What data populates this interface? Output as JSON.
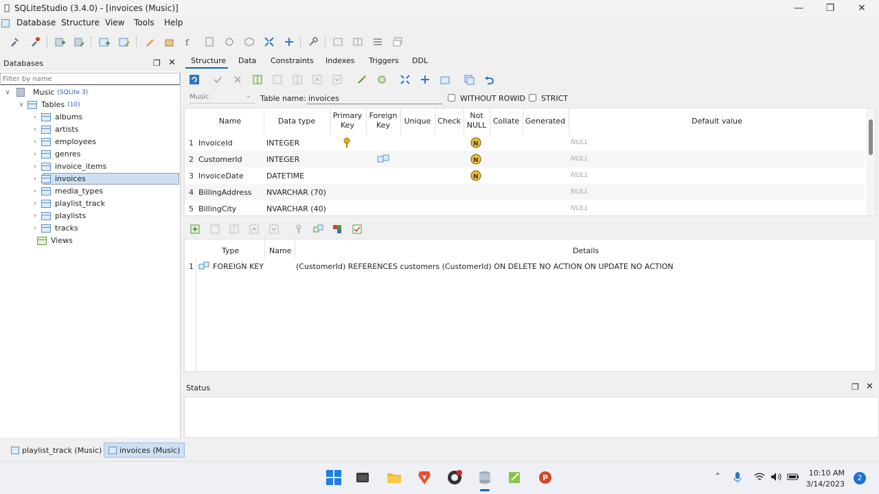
{
  "window": {
    "title": "SQLiteStudio (3.4.0) - [invoices (Music)]"
  },
  "menu": [
    "Database",
    "Structure",
    "View",
    "Tools",
    "Help"
  ],
  "db_panel": {
    "title": "Databases",
    "filter_placeholder": "Filter by name",
    "db_name": "Music",
    "db_version": "(SQLite 3)",
    "tables_label": "Tables",
    "tables_count": "(10)",
    "tables": [
      "albums",
      "artists",
      "employees",
      "genres",
      "invoice_items",
      "invoices",
      "media_types",
      "playlist_track",
      "playlists",
      "tracks"
    ],
    "selected_table": "invoices",
    "views_label": "Views"
  },
  "editor_tabs": [
    "Structure",
    "Data",
    "Constraints",
    "Indexes",
    "Triggers",
    "DDL"
  ],
  "table_form": {
    "db_combo": "Music",
    "table_name_label": "Table name:",
    "table_name_value": "invoices",
    "without_rowid": "WITHOUT ROWID",
    "strict": "STRICT"
  },
  "columns_header": {
    "name": "Name",
    "type": "Data type",
    "pk1": "Primary",
    "pk2": "Key",
    "fk1": "Foreign",
    "fk2": "Key",
    "unique": "Unique",
    "check": "Check",
    "nn1": "Not",
    "nn2": "NULL",
    "collate": "Collate",
    "generated": "Generated",
    "default": "Default value"
  },
  "columns": [
    {
      "n": "1",
      "name": "InvoiceId",
      "type": "INTEGER",
      "pk": true,
      "fk": false,
      "nn": true,
      "default": "NULL"
    },
    {
      "n": "2",
      "name": "CustomerId",
      "type": "INTEGER",
      "pk": false,
      "fk": true,
      "nn": true,
      "default": "NULL"
    },
    {
      "n": "3",
      "name": "InvoiceDate",
      "type": "DATETIME",
      "pk": false,
      "fk": false,
      "nn": true,
      "default": "NULL"
    },
    {
      "n": "4",
      "name": "BillingAddress",
      "type": "NVARCHAR (70)",
      "pk": false,
      "fk": false,
      "nn": false,
      "default": "NULL"
    },
    {
      "n": "5",
      "name": "BillingCity",
      "type": "NVARCHAR (40)",
      "pk": false,
      "fk": false,
      "nn": false,
      "default": "NULL"
    }
  ],
  "constraints_header": {
    "type": "Type",
    "name": "Name",
    "details": "Details"
  },
  "constraints": [
    {
      "n": "1",
      "type": "FOREIGN KEY",
      "name": "",
      "details": "(CustomerId) REFERENCES customers (CustomerId) ON DELETE NO ACTION ON UPDATE NO ACTION"
    }
  ],
  "status_title": "Status",
  "bottom_tabs": [
    "playlist_track (Music)",
    "invoices (Music)"
  ],
  "clock": {
    "time": "10:10 AM",
    "date": "3/14/2023"
  },
  "notification_count": "2",
  "colors": {
    "selection": "#cde0f4",
    "accent": "#0a63b8",
    "key": "#e0b020",
    "nn": "#f2c230"
  }
}
